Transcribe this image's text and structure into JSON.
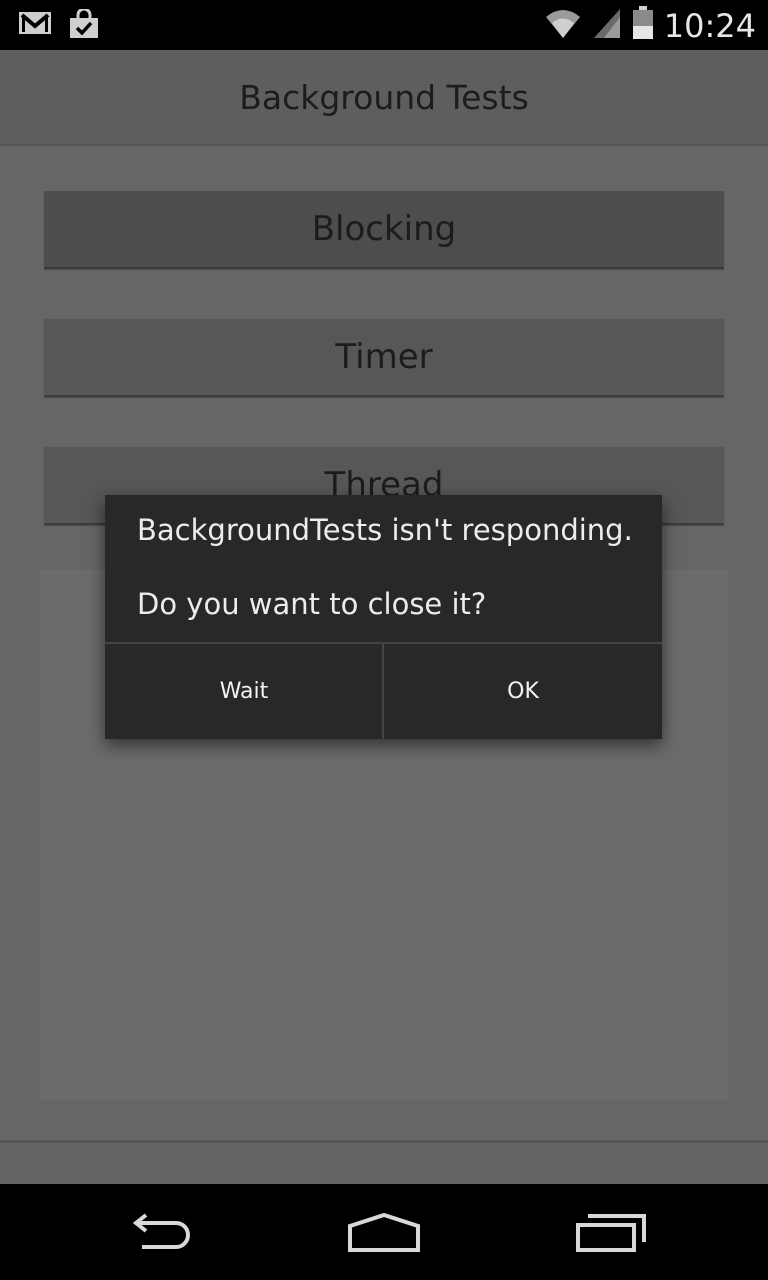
{
  "status_bar": {
    "time": "10:24",
    "icons": [
      "gmail-icon",
      "shopping-bag-check-icon",
      "wifi-icon",
      "signal-icon",
      "battery-icon"
    ]
  },
  "action_bar": {
    "title": "Background Tests"
  },
  "buttons": {
    "blocking": "Blocking",
    "timer": "Timer",
    "thread": "Thread"
  },
  "dialog": {
    "message_line1": "BackgroundTests isn't responding.",
    "message_line2": "Do you want to close it?",
    "wait_label": "Wait",
    "ok_label": "OK"
  },
  "nav_bar": {
    "icons": [
      "back-icon",
      "home-icon",
      "recent-apps-icon"
    ]
  },
  "colors": {
    "dim_background": "#666666",
    "dialog_bg": "#282828",
    "status_bar": "#000000"
  }
}
